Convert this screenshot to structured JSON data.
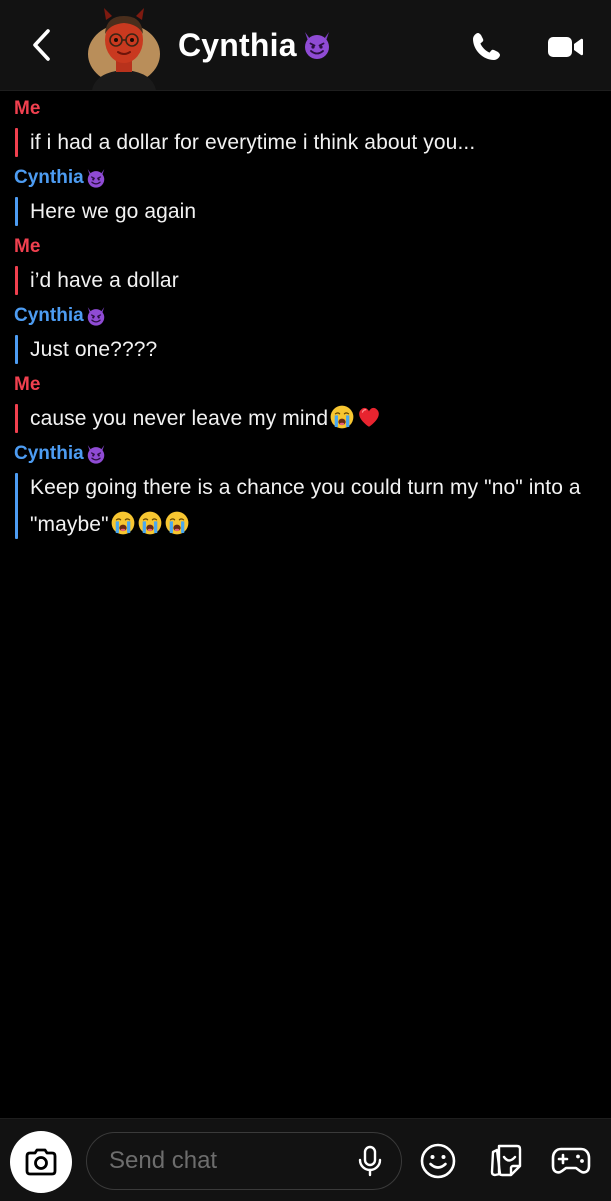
{
  "header": {
    "contact_name": "Cynthia",
    "contact_emoji": "smiling-devil-emoji",
    "back_icon": "chevron-left-icon",
    "call_icon": "phone-icon",
    "video_icon": "video-camera-icon"
  },
  "colors": {
    "me": "#f0404f",
    "them": "#4d9cf2",
    "background": "#000000",
    "bar": "#121212"
  },
  "messages": [
    {
      "sender": "Me",
      "text": "if i had a dollar for everytime i think about you..."
    },
    {
      "sender": "Cynthia",
      "text": "Here we go again"
    },
    {
      "sender": "Me",
      "text": "i’d have a dollar"
    },
    {
      "sender": "Cynthia",
      "text": "Just one????"
    },
    {
      "sender": "Me",
      "text": "cause you never leave my mind",
      "emojis": [
        "loudly-crying-face",
        "red-heart"
      ]
    },
    {
      "sender": "Cynthia",
      "text": "Keep going there is a chance you could turn my \"no\" into a \"maybe\"",
      "emojis": [
        "loudly-crying-face",
        "loudly-crying-face",
        "loudly-crying-face"
      ]
    }
  ],
  "composer": {
    "placeholder": "Send chat",
    "camera_icon": "camera-icon",
    "mic_icon": "microphone-icon",
    "emoji_icon": "smiley-icon",
    "sticker_icon": "sticker-icon",
    "games_icon": "game-controller-icon"
  }
}
